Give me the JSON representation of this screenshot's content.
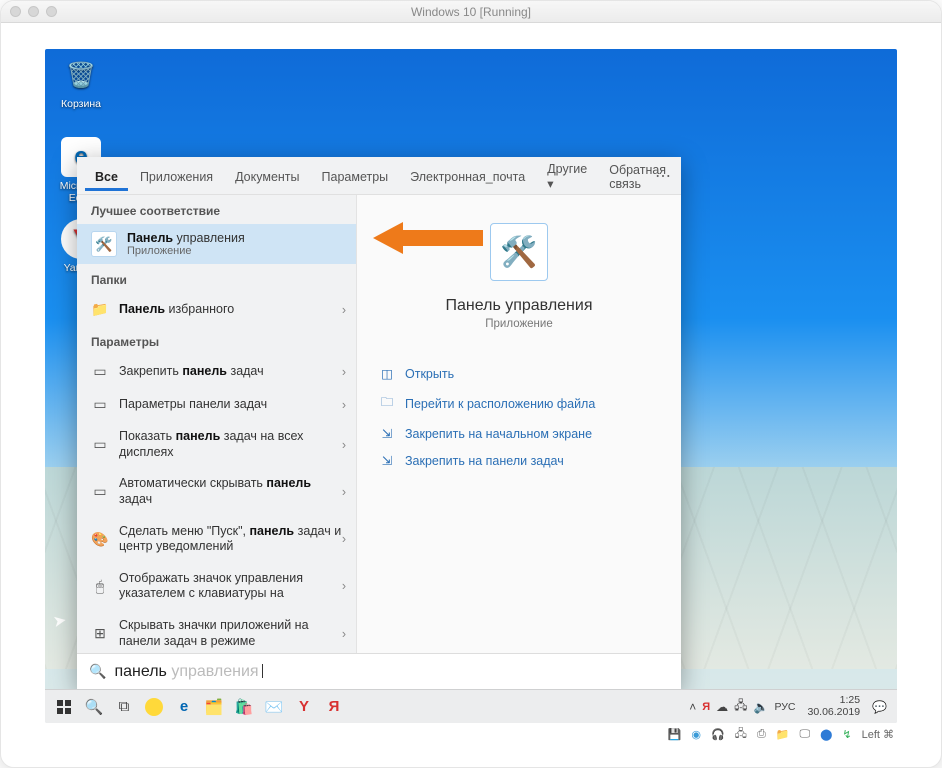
{
  "host_title": "Windows 10 [Running]",
  "desktop": {
    "recycle": "Корзина",
    "edge": "Microsoft Edge",
    "yandex": "Yandex"
  },
  "search": {
    "tabs": [
      "Все",
      "Приложения",
      "Документы",
      "Параметры",
      "Электронная_почта",
      "Другие ▾",
      "Обратная связь"
    ],
    "section_best": "Лучшее соответствие",
    "best_title_bold": "Панель",
    "best_title_rest": " управления",
    "best_sub": "Приложение",
    "section_folders": "Папки",
    "folder_bold": "Панель",
    "folder_rest": " избранного",
    "section_settings": "Параметры",
    "settings": [
      {
        "icon": "⬛",
        "bold": "панель",
        "pre": "Закрепить ",
        "post": " задач"
      },
      {
        "icon": "⬛",
        "bold": "",
        "pre": "Параметры панели задач",
        "post": ""
      },
      {
        "icon": "⬛",
        "bold": "панель",
        "pre": "Показать ",
        "post": " задач на всех дисплеях"
      },
      {
        "icon": "⬛",
        "bold": "панель",
        "pre": "Автоматически скрывать ",
        "post": " задач"
      },
      {
        "icon": "🎨",
        "bold": "панель",
        "pre": "Сделать меню \"Пуск\", ",
        "post": " задач и центр уведомлений"
      },
      {
        "icon": "🖱",
        "bold": "",
        "pre": "Отображать значок управления указателем с клавиатуры на",
        "post": ""
      },
      {
        "icon": "⊞",
        "bold": "",
        "pre": "Скрывать значки приложений на панели задач в режиме",
        "post": ""
      }
    ],
    "typed": "панель",
    "ghost": " управления",
    "details_title": "Панель управления",
    "details_sub": "Приложение",
    "actions": [
      {
        "icon": "⧉",
        "label": "Открыть"
      },
      {
        "icon": "📁",
        "label": "Перейти к расположению файла"
      },
      {
        "icon": "📌",
        "label": "Закрепить на начальном экране"
      },
      {
        "icon": "📌",
        "label": "Закрепить на панели задач"
      }
    ]
  },
  "taskbar": {
    "lang": "РУС",
    "time": "1:25",
    "date": "30.06.2019"
  },
  "hostbar": {
    "right": "Left ⌘"
  }
}
